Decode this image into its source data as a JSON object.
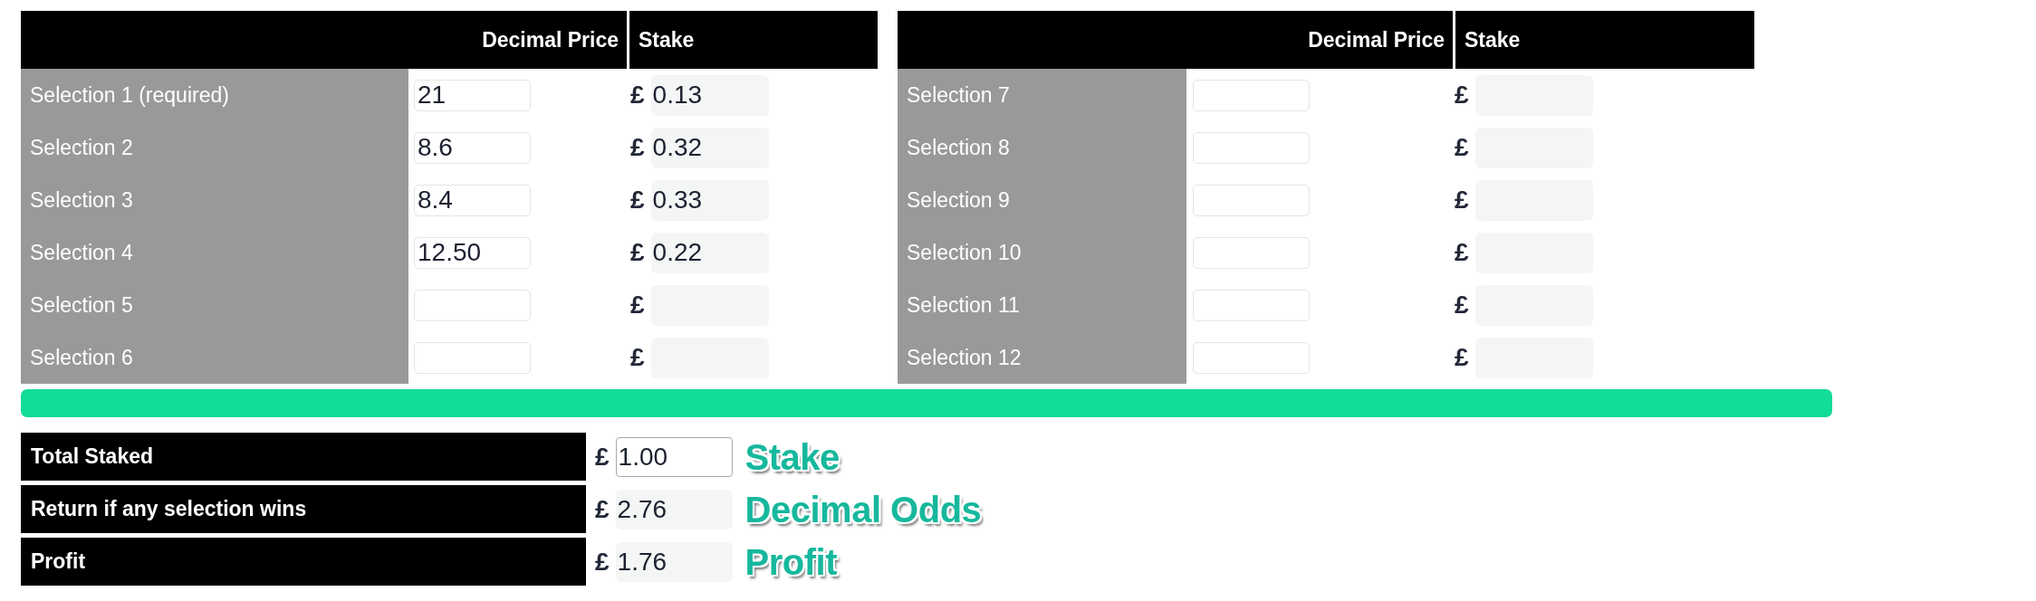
{
  "tables": [
    {
      "columns": [
        "Decimal Price",
        "Stake"
      ],
      "rows": [
        {
          "label": "Selection 1 (required)",
          "price": "21",
          "currency": "£",
          "stake": "0.13"
        },
        {
          "label": "Selection 2",
          "price": "8.6",
          "currency": "£",
          "stake": "0.32"
        },
        {
          "label": "Selection 3",
          "price": "8.4",
          "currency": "£",
          "stake": "0.33"
        },
        {
          "label": "Selection 4",
          "price": "12.50",
          "currency": "£",
          "stake": "0.22"
        },
        {
          "label": "Selection 5",
          "currency": "£"
        },
        {
          "label": "Selection 6",
          "currency": "£"
        }
      ]
    },
    {
      "columns": [
        "Decimal Price",
        "Stake"
      ],
      "rows": [
        {
          "label": "Selection 7",
          "currency": "£"
        },
        {
          "label": "Selection 8",
          "currency": "£"
        },
        {
          "label": "Selection 9",
          "currency": "£"
        },
        {
          "label": "Selection 10",
          "currency": "£"
        },
        {
          "label": "Selection 11",
          "currency": "£"
        },
        {
          "label": "Selection 12",
          "currency": "£"
        }
      ]
    }
  ],
  "summary": [
    {
      "kind": "input",
      "label": "Total Staked",
      "currency": "£",
      "value": "1.00",
      "annotation": "Stake"
    },
    {
      "kind": "output",
      "label": "Return if any selection wins",
      "currency": "£",
      "value": "2.76",
      "annotation": "Decimal Odds"
    },
    {
      "kind": "output",
      "label": "Profit",
      "currency": "£",
      "value": "1.76",
      "annotation": "Profit"
    }
  ]
}
